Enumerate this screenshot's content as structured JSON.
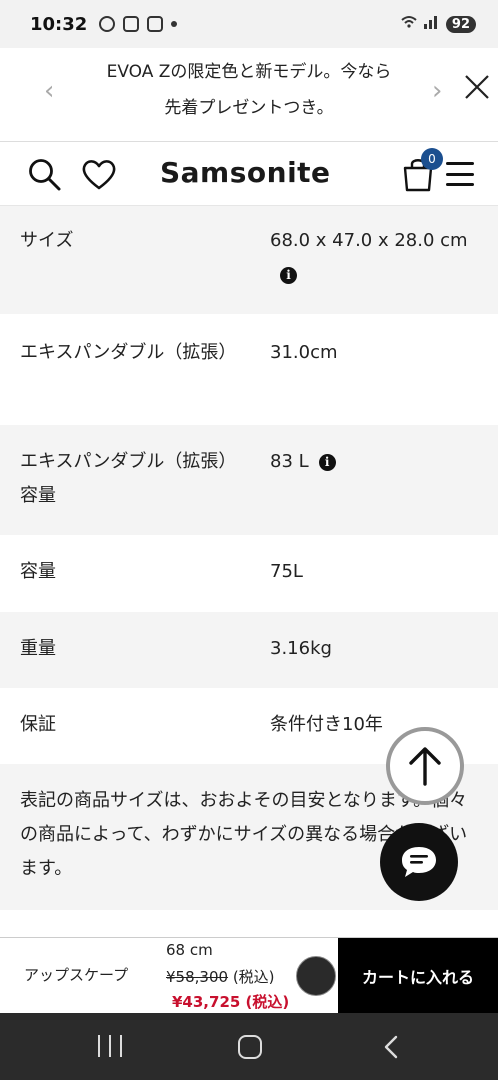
{
  "status_bar": {
    "time": "10:32",
    "battery": "92"
  },
  "promo": {
    "line1": "EVOA Zの限定色と新モデル。今なら",
    "line2": "先着プレゼントつき。"
  },
  "header": {
    "logo": "Samsonite",
    "cart_count": "0"
  },
  "specs": [
    {
      "label": "サイズ",
      "value": "68.0 x 47.0 x 28.0 cm",
      "info": true
    },
    {
      "label": "エキスパンダブル（拡張）",
      "value": "31.0cm",
      "info": false
    },
    {
      "label": "エキスパンダブル（拡張）容量",
      "value": "83 L",
      "info": true
    },
    {
      "label": "容量",
      "value": "75L",
      "info": false
    },
    {
      "label": "重量",
      "value": "3.16kg",
      "info": false
    },
    {
      "label": "保証",
      "value": "条件付き10年",
      "info": false
    }
  ],
  "note": "表記の商品サイズは、おおよその目安となります。個々の商品によって、わずかにサイズの異なる場合がございます。",
  "cart_bar": {
    "product_name": "アップスケープ",
    "size": "68 cm",
    "original_price": "¥58,300",
    "tax_label": "(税込)",
    "sale_price": "¥43,725 (税込)",
    "add_to_cart": "カートに入れる"
  }
}
